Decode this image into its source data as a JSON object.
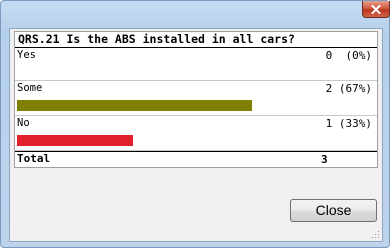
{
  "window": {
    "close_icon": "close-x-icon"
  },
  "poll": {
    "question": "QRS.21 Is the ABS installed in all cars?",
    "options": [
      {
        "label": "Yes",
        "count": "0  (0%)",
        "fraction": 0.0,
        "color": "#808000"
      },
      {
        "label": "Some",
        "count": "2 (67%)",
        "fraction": 0.67,
        "color": "#808000"
      },
      {
        "label": "No",
        "count": "1 (33%)",
        "fraction": 0.33,
        "color": "#e0202a"
      }
    ],
    "total_label": "Total",
    "total_value": "3"
  },
  "dialog": {
    "close_button_label": "Close"
  }
}
